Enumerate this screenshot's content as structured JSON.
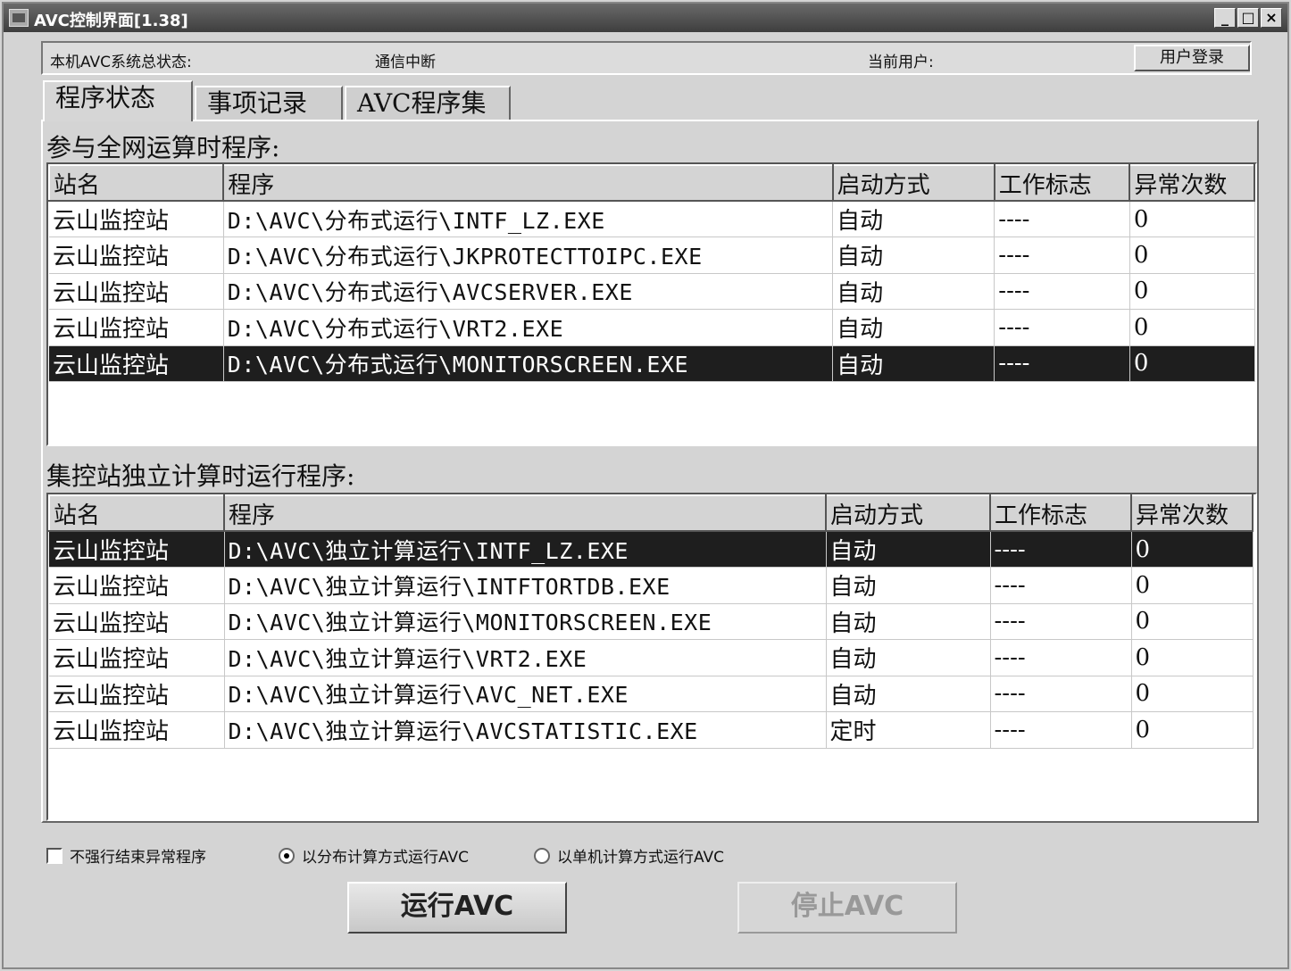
{
  "window": {
    "title": "AVC控制界面[1.38]",
    "minimize": "_",
    "maximize": "□",
    "close": "×"
  },
  "status": {
    "system_label": "本机AVC系统总状态:",
    "system_value": "通信中断",
    "user_label": "当前用户:",
    "login_button": "用户登录"
  },
  "tabs": [
    {
      "label": "程序状态",
      "active": true
    },
    {
      "label": "事项记录",
      "active": false
    },
    {
      "label": "AVC程序集",
      "active": false
    }
  ],
  "section1": {
    "title": "参与全网运算时程序:",
    "columns": [
      "站名",
      "程序",
      "启动方式",
      "工作标志",
      "异常次数"
    ],
    "rows": [
      [
        "云山监控站",
        "D:\\AVC\\分布式运行\\INTF_LZ.EXE",
        "自动",
        "----",
        "0"
      ],
      [
        "云山监控站",
        "D:\\AVC\\分布式运行\\JKPROTECTTOIPC.EXE",
        "自动",
        "----",
        "0"
      ],
      [
        "云山监控站",
        "D:\\AVC\\分布式运行\\AVCSERVER.EXE",
        "自动",
        "----",
        "0"
      ],
      [
        "云山监控站",
        "D:\\AVC\\分布式运行\\VRT2.EXE",
        "自动",
        "----",
        "0"
      ],
      [
        "云山监控站",
        "D:\\AVC\\分布式运行\\MONITORSCREEN.EXE",
        "自动",
        "----",
        "0"
      ]
    ],
    "selected_row": 4
  },
  "section2": {
    "title": "集控站独立计算时运行程序:",
    "columns": [
      "站名",
      "程序",
      "启动方式",
      "工作标志",
      "异常次数"
    ],
    "rows": [
      [
        "云山监控站",
        "D:\\AVC\\独立计算运行\\INTF_LZ.EXE",
        "自动",
        "----",
        "0"
      ],
      [
        "云山监控站",
        "D:\\AVC\\独立计算运行\\INTFTORTDB.EXE",
        "自动",
        "----",
        "0"
      ],
      [
        "云山监控站",
        "D:\\AVC\\独立计算运行\\MONITORSCREEN.EXE",
        "自动",
        "----",
        "0"
      ],
      [
        "云山监控站",
        "D:\\AVC\\独立计算运行\\VRT2.EXE",
        "自动",
        "----",
        "0"
      ],
      [
        "云山监控站",
        "D:\\AVC\\独立计算运行\\AVC_NET.EXE",
        "自动",
        "----",
        "0"
      ],
      [
        "云山监控站",
        "D:\\AVC\\独立计算运行\\AVCSTATISTIC.EXE",
        "定时",
        "----",
        "0"
      ]
    ],
    "selected_row": 0
  },
  "options": {
    "no_force_kill": {
      "label": "不强行结束异常程序",
      "checked": false
    },
    "distributed_mode": {
      "label": "以分布计算方式运行AVC",
      "checked": true
    },
    "standalone_mode": {
      "label": "以单机计算方式运行AVC",
      "checked": false
    }
  },
  "buttons": {
    "run": "运行AVC",
    "stop": "停止AVC",
    "stop_enabled": false
  }
}
